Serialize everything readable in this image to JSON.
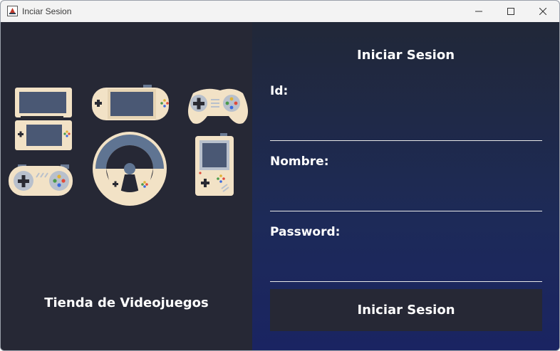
{
  "window": {
    "title": "Inciar Sesion",
    "controls": {
      "minimize": "minimize-icon",
      "maximize": "maximize-icon",
      "close": "close-icon"
    }
  },
  "left_panel": {
    "illustration": "video-game-consoles-illustration",
    "store_label": "Tienda de Videojuegos"
  },
  "form": {
    "title": "Iniciar Sesion",
    "fields": [
      {
        "label": "Id:",
        "value": ""
      },
      {
        "label": "Nombre:",
        "value": ""
      },
      {
        "label": "Password:",
        "value": ""
      }
    ],
    "submit_label": "Iniciar Sesion"
  },
  "colors": {
    "left_bg": "#262835",
    "right_bg_top": "#212838",
    "right_bg_bottom": "#1a2462",
    "console_body": "#f2e2c6",
    "console_screen": "#4a5874",
    "button_bg": "#262835"
  }
}
